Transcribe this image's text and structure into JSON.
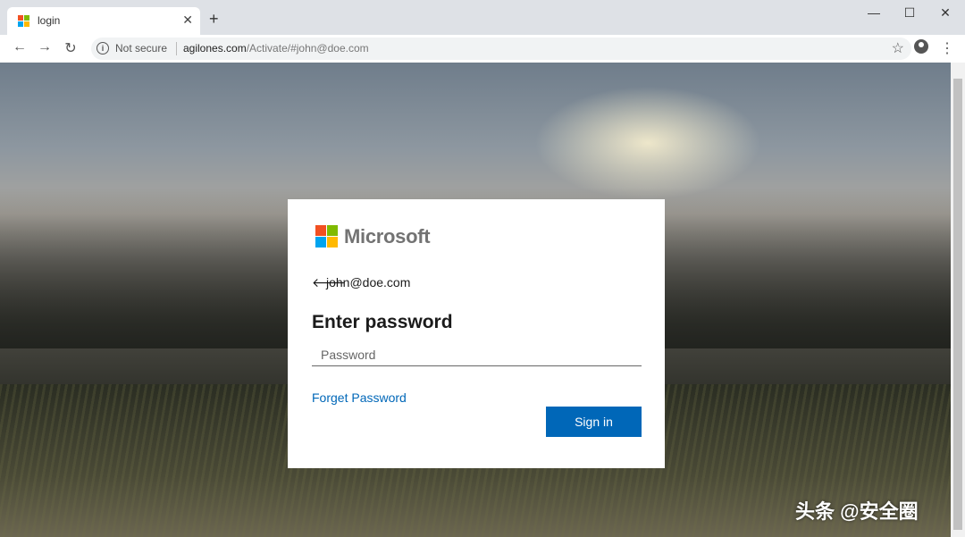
{
  "browser": {
    "tab_title": "login",
    "tab_close": "✕",
    "new_tab": "+",
    "window_controls": {
      "minimize": "—",
      "maximize": "☐",
      "close": "✕"
    },
    "nav": {
      "back": "←",
      "forward": "→",
      "reload": "↻"
    },
    "security_label": "Not secure",
    "url_domain": "agilones.com",
    "url_path": "/Activate/#john@doe.com",
    "bookmark": "☆",
    "menu": "⋮"
  },
  "login": {
    "brand": "Microsoft",
    "back_arrow": "🡐",
    "identity": "john@doe.com",
    "heading": "Enter password",
    "password_placeholder": "Password",
    "forget_link": "Forget Password",
    "signin_label": "Sign in",
    "colors": {
      "accent": "#0067b8"
    }
  },
  "watermark": "头条 @安全圈"
}
